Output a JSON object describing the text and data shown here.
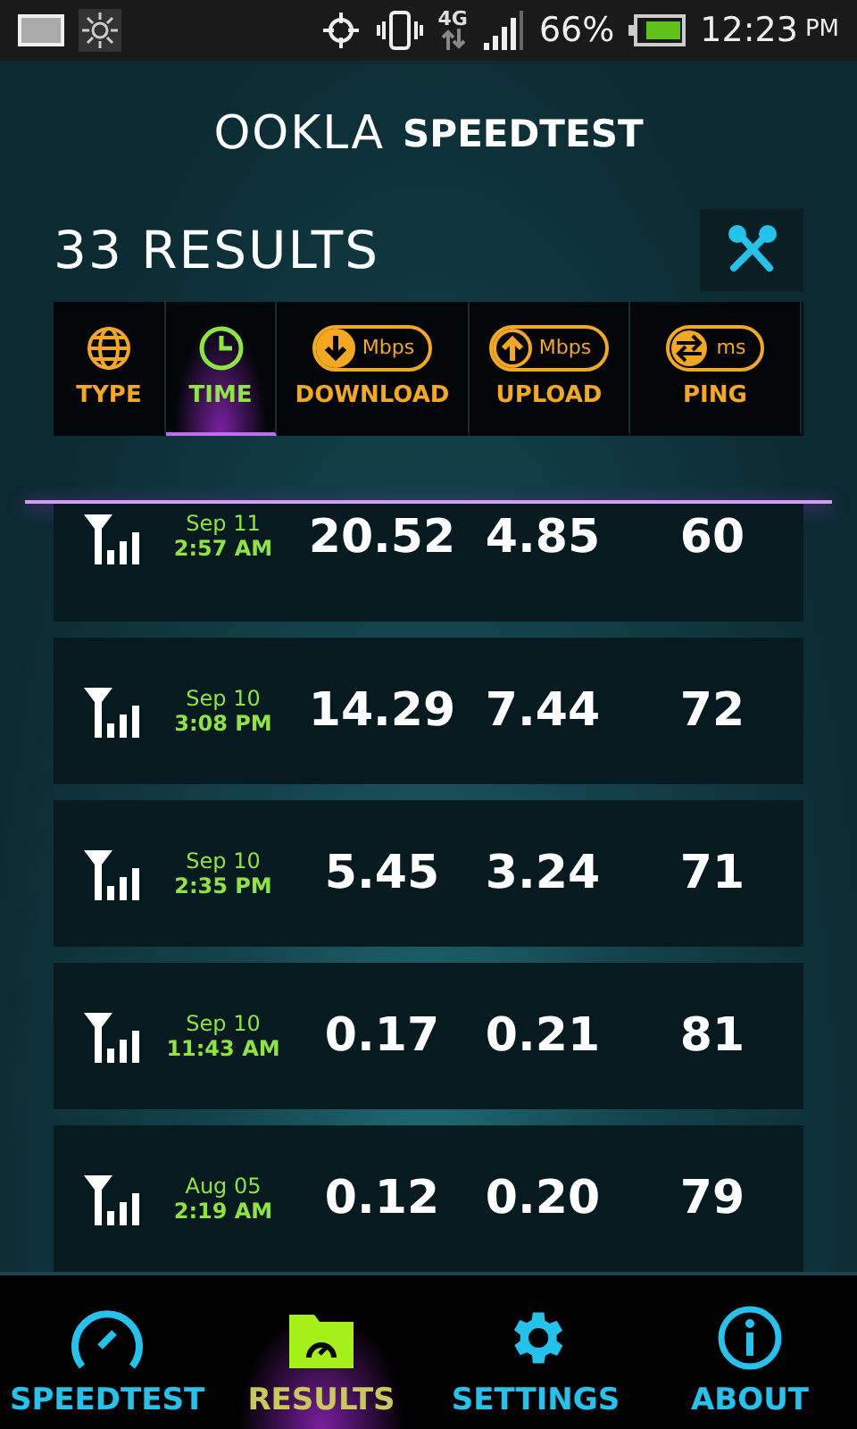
{
  "status_bar": {
    "network": "4G",
    "battery": "66%",
    "time": "12:23",
    "ampm": "PM"
  },
  "logo": {
    "brand": "OOKLA",
    "product": "SPEEDTEST"
  },
  "title": "33 RESULTS",
  "sort_columns": [
    {
      "kind": "globe",
      "label": "TYPE",
      "selected": false
    },
    {
      "kind": "clock",
      "label": "TIME",
      "selected": true
    },
    {
      "kind": "download",
      "label": "DOWNLOAD",
      "unit": "Mbps",
      "selected": false
    },
    {
      "kind": "upload",
      "label": "UPLOAD",
      "unit": "Mbps",
      "selected": false
    },
    {
      "kind": "ping",
      "label": "PING",
      "unit": "ms",
      "selected": false
    }
  ],
  "results": [
    {
      "date": "Sep 11",
      "time": "2:57 AM",
      "download": "20.52",
      "upload": "4.85",
      "ping": "60"
    },
    {
      "date": "Sep 10",
      "time": "3:08 PM",
      "download": "14.29",
      "upload": "7.44",
      "ping": "72"
    },
    {
      "date": "Sep 10",
      "time": "2:35 PM",
      "download": "5.45",
      "upload": "3.24",
      "ping": "71"
    },
    {
      "date": "Sep 10",
      "time": "11:43 AM",
      "download": "0.17",
      "upload": "0.21",
      "ping": "81"
    },
    {
      "date": "Aug 05",
      "time": "2:19 AM",
      "download": "0.12",
      "upload": "0.20",
      "ping": "79"
    }
  ],
  "nav": [
    {
      "kind": "gauge",
      "label": "SPEEDTEST",
      "selected": false
    },
    {
      "kind": "folder",
      "label": "RESULTS",
      "selected": true
    },
    {
      "kind": "gear",
      "label": "SETTINGS",
      "selected": false
    },
    {
      "kind": "info",
      "label": "ABOUT",
      "selected": false
    }
  ]
}
